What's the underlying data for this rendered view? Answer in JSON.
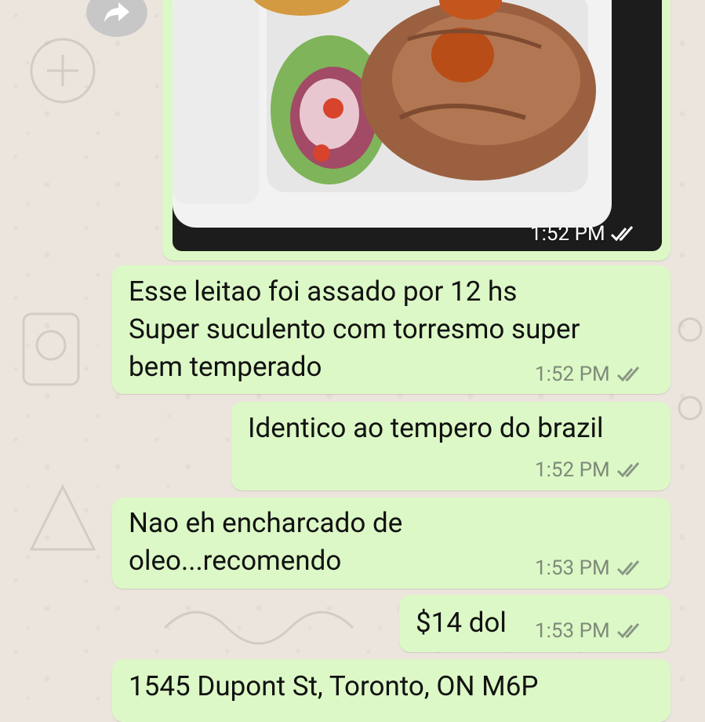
{
  "icons": {
    "forward_button": "forward-share-icon",
    "read_ticks": "double-check-icon"
  },
  "colors": {
    "bubble": "#dcf8c6",
    "background": "#ece5dd",
    "meta": "#7f8a7a"
  },
  "messages": [
    {
      "type": "image",
      "alt": "pulled pork plate with salad",
      "time": "1:52 PM"
    },
    {
      "type": "text",
      "lines": [
        "Esse leitao foi assado por 12 hs",
        "Super suculento com torresmo super",
        "bem temperado"
      ],
      "time": "1:52 PM"
    },
    {
      "type": "text",
      "lines": [
        "Identico ao tempero do brazil"
      ],
      "time": "1:52 PM"
    },
    {
      "type": "text",
      "lines": [
        "Nao eh encharcado de",
        "oleo...recomendo"
      ],
      "time": "1:53 PM"
    },
    {
      "type": "text",
      "lines": [
        "$14 dol"
      ],
      "time": "1:53 PM"
    },
    {
      "type": "text",
      "lines": [
        "1545 Dupont St, Toronto, ON M6P"
      ],
      "time": ""
    }
  ]
}
